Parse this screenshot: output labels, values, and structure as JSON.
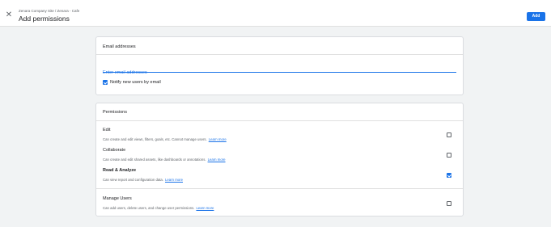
{
  "header": {
    "close_icon": "close-icon",
    "breadcrumb": "Zenara Company Site / Zenara - Cafe",
    "title": "Add permissions",
    "add_label": "Add"
  },
  "email_section": {
    "title": "Email addresses",
    "input_placeholder": "Enter email addresses",
    "input_value": "",
    "notify_label": "Notify new users by email",
    "notify_checked": true
  },
  "permissions_section": {
    "title": "Permissions",
    "items": [
      {
        "title": "Edit",
        "description": "Can create and edit views, filters, goals, etc. Cannot manage users.",
        "link": "Learn more",
        "checked": false
      },
      {
        "title": "Collaborate",
        "description": "Can create and edit shared assets, like dashboards or annotations.",
        "link": "Learn more",
        "checked": false
      },
      {
        "title": "Read & Analyze",
        "description": "Can view report and configuration data.",
        "link": "Learn more",
        "checked": true
      },
      {
        "title": "Manage Users",
        "description": "Can add users, delete users, and change user permissions.",
        "link": "Learn more",
        "checked": false
      }
    ]
  },
  "colors": {
    "accent": "#1a73e8",
    "background": "#f1f3f4",
    "card": "#ffffff"
  }
}
